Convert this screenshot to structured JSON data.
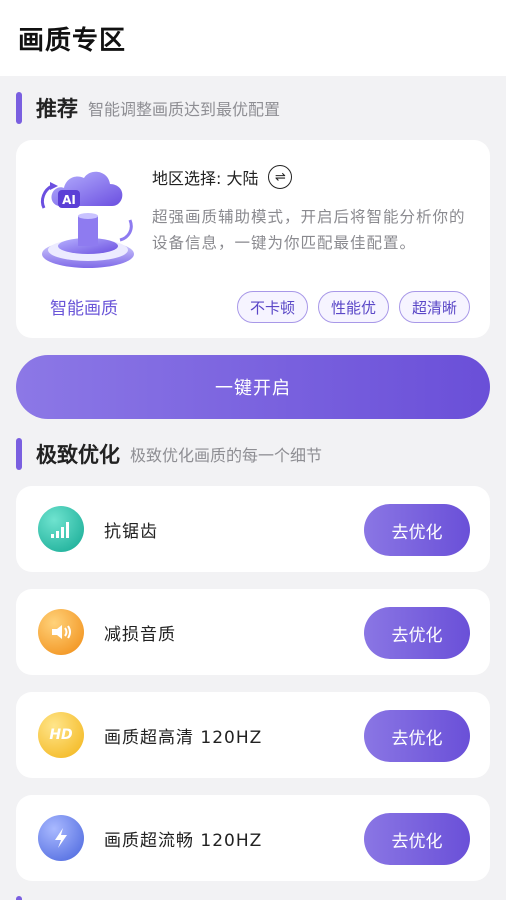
{
  "page": {
    "title": "画质专区"
  },
  "recommend": {
    "title": "推荐",
    "subtitle": "智能调整画质达到最优配置",
    "region_label": "地区选择: 大陆",
    "description": "超强画质辅助模式，开启后将智能分析你的设备信息，一键为你匹配最佳配置。",
    "caption": "智能画质",
    "ai_badge": "AI",
    "tags": [
      "不卡顿",
      "性能优",
      "超清晰"
    ],
    "primary_button": "一键开启"
  },
  "optimize": {
    "title": "极致优化",
    "subtitle": "极致优化画质的每一个细节",
    "items": [
      {
        "label": "抗锯齿",
        "button": "去优化",
        "icon": "signal-bars-icon",
        "color": "#1fb8a4"
      },
      {
        "label": "减损音质",
        "button": "去优化",
        "icon": "speaker-icon",
        "color": "#f5a623"
      },
      {
        "label": "画质超高清 120HZ",
        "button": "去优化",
        "icon": "hd-icon",
        "icon_text": "HD",
        "color": "#f7c32e"
      },
      {
        "label": "画质超流畅 120HZ",
        "button": "去优化",
        "icon": "lightning-icon",
        "color": "#5e7be8"
      }
    ]
  }
}
